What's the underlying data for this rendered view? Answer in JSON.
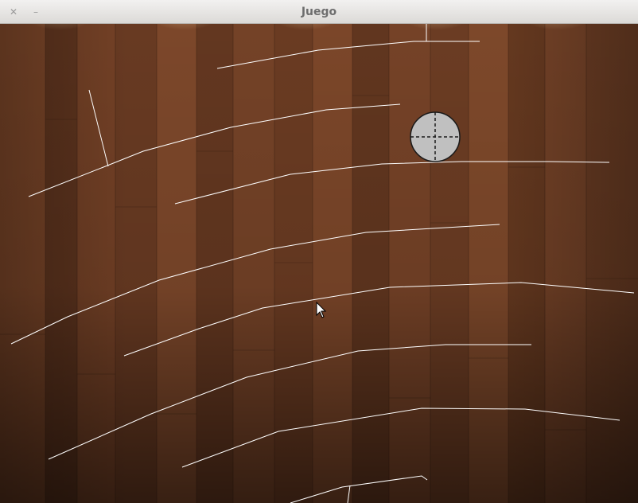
{
  "window": {
    "title": "Juego",
    "close_glyph": "✕",
    "minimize_glyph": "–"
  },
  "colors": {
    "wood_light": "#8a4f2e",
    "wood_dark": "#2a1a12",
    "line": "#ffffff",
    "ball_fill": "#c0c0c0",
    "ball_stroke": "#1a1a1a"
  },
  "icons": [
    "close-icon",
    "minimize-icon",
    "mouse-cursor-icon"
  ]
}
